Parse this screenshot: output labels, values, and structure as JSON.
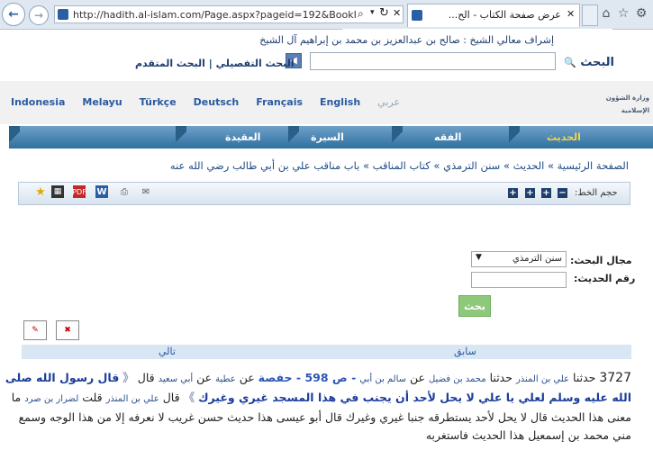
{
  "browser": {
    "url": "http://hadith.al-islam.com/Page.aspx?pageid=192&BookI",
    "tab_title": "عرض صفحة الكتاب - الح...",
    "back_icon": "back-arrow-icon",
    "forward_icon": "forward-arrow-icon"
  },
  "header": {
    "sheikh_line": "إشراف معالي الشيخ : صالح بن عبدالعزيز بن محمد بن إبراهيم آل الشيخ",
    "search_label": "البحث",
    "search_value": "",
    "advanced_links": "البحث التفصيلي | البحث المتقدم",
    "languages": [
      "Indonesia",
      "Melayu",
      "Türkçe",
      "Deutsch",
      "Français",
      "English",
      "عربي"
    ],
    "logo_text": "وزارة الشؤون الإسلامية"
  },
  "nav": {
    "items": [
      "الحديث",
      "الفقه",
      "السيرة",
      "العقيدة"
    ],
    "accent": "#f3d64a"
  },
  "breadcrumb": "الصفحة الرئيسية » الحديث » سنن الترمذي » كتاب المناقب » باب مناقب علي بن أبي طالب رضي الله عنه",
  "toolbar": {
    "font_size_label": "حجم الخط:",
    "font_buttons": [
      "−",
      "+",
      "+",
      "+"
    ],
    "icons": [
      "email-icon",
      "print-icon",
      "word-icon",
      "pdf-icon",
      "save-icon",
      "favorite-icon"
    ]
  },
  "search_form": {
    "field_label": "مجال البحث:",
    "selected_book": "سنن الترمذي",
    "hadith_label": "رقم الحديث:",
    "hadith_value": "",
    "button_label": "بحث"
  },
  "pager": {
    "prev": "سابق",
    "next": "تالي"
  },
  "hadith": {
    "number": "3727",
    "p1": "حدثنا",
    "n1": "علي بن المنذر",
    "p2": "حدثنا",
    "n2": "محمد بن فضيل",
    "p3": "عن",
    "n3": "سالم بن أبي",
    "page_ref": "- ص 598 - حفصة",
    "p4": "عن",
    "n4": "عطية",
    "p5": "عن",
    "n5": "أبي سعيد",
    "p6": "قال",
    "quote": "قال رسول الله صلى الله عليه وسلم لعلي يا علي لا يحل لأحد أن يجنب في هذا المسجد غيري وغيرك",
    "p7": "قال",
    "n6": "علي بن المنذر",
    "p8": "قلت",
    "n7": "لضرار بن صرد",
    "rest": "ما معنى هذا الحديث قال لا يحل لأحد يستطرقه جنبا غيري وغيرك قال أبو عيسى هذا حديث حسن غريب لا نعرفه إلا من هذا الوجه وسمع مني محمد بن إسمعيل هذا الحديث فاستغربه"
  }
}
